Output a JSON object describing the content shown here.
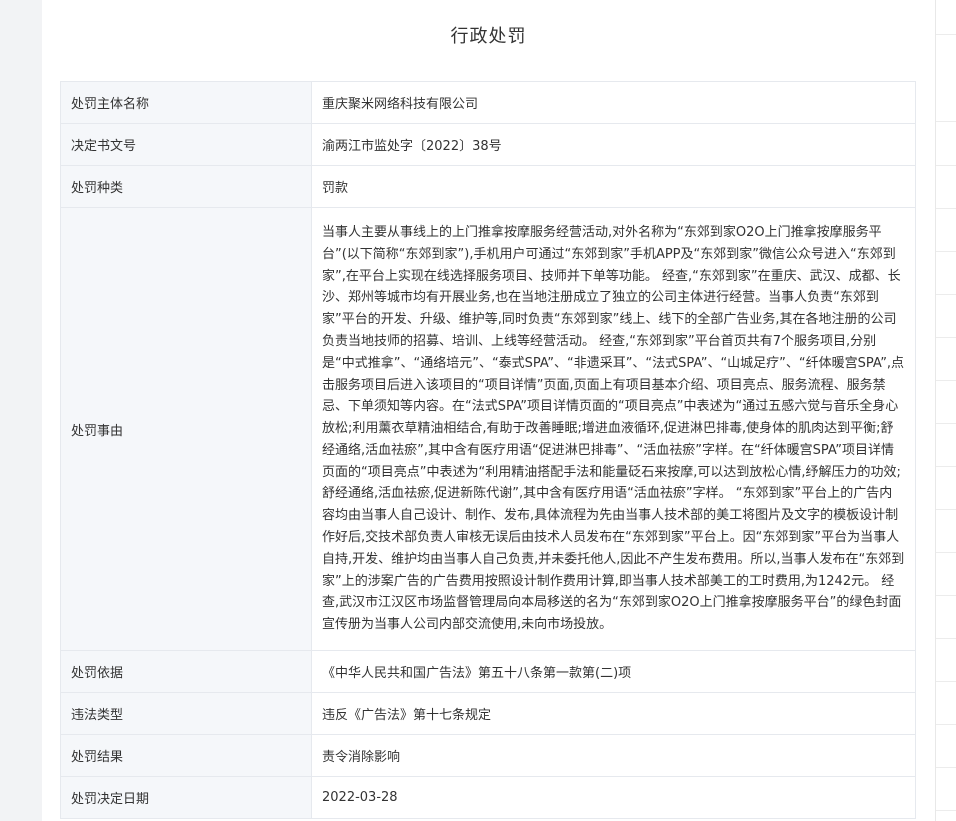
{
  "page": {
    "title": "行政处罚"
  },
  "rows": [
    {
      "label": "处罚主体名称",
      "value": "重庆聚米网络科技有限公司"
    },
    {
      "label": "决定书文号",
      "value": "渝两江市监处字〔2022〕38号"
    },
    {
      "label": "处罚种类",
      "value": "罚款"
    },
    {
      "label": "处罚事由",
      "value": "当事人主要从事线上的上门推拿按摩服务经营活动,对外名称为“东郊到家O2O上门推拿按摩服务平台”(以下简称“东郊到家”),手机用户可通过“东郊到家”手机APP及“东郊到家”微信公众号进入“东郊到家”,在平台上实现在线选择服务项目、技师并下单等功能。 经查,“东郊到家”在重庆、武汉、成都、长沙、郑州等城市均有开展业务,也在当地注册成立了独立的公司主体进行经营。当事人负责“东郊到家”平台的开发、升级、维护等,同时负责“东郊到家”线上、线下的全部广告业务,其在各地注册的公司负责当地技师的招募、培训、上线等经营活动。 经查,“东郊到家”平台首页共有7个服务项目,分别是“中式推拿”、“通络培元”、“泰式SPA”、“非遗采耳”、“法式SPA”、“山城足疗”、“纤体暖宫SPA”,点击服务项目后进入该项目的“项目详情”页面,页面上有项目基本介绍、项目亮点、服务流程、服务禁忌、下单须知等内容。在“法式SPA”项目详情页面的“项目亮点”中表述为“通过五感六觉与音乐全身心放松;利用薰衣草精油相结合,有助于改善睡眠;增进血液循环,促进淋巴排毒,使身体的肌肉达到平衡;舒经通络,活血祛瘀”,其中含有医疗用语“促进淋巴排毒”、“活血祛瘀”字样。在“纤体暖宫SPA”项目详情页面的“项目亮点”中表述为“利用精油搭配手法和能量砭石来按摩,可以达到放松心情,纾解压力的功效;舒经通络,活血祛瘀,促进新陈代谢”,其中含有医疗用语“活血祛瘀”字样。 “东郊到家”平台上的广告内容均由当事人自己设计、制作、发布,具体流程为先由当事人技术部的美工将图片及文字的模板设计制作好后,交技术部负责人审核无误后由技术人员发布在“东郊到家”平台上。因“东郊到家”平台为当事人自持,开发、维护均由当事人自己负责,并未委托他人,因此不产生发布费用。所以,当事人发布在“东郊到家”上的涉案广告的广告费用按照设计制作费用计算,即当事人技术部美工的工时费用,为1242元。 经查,武汉市江汉区市场监督管理局向本局移送的名为“东郊到家O2O上门推拿按摩服务平台”的绿色封面宣传册为当事人公司内部交流使用,未向市场投放。"
    },
    {
      "label": "处罚依据",
      "value": "《中华人民共和国广告法》第五十八条第一款第(二)项"
    },
    {
      "label": "违法类型",
      "value": "违反《广告法》第十七条规定"
    },
    {
      "label": "处罚结果",
      "value": "责令消除影响"
    },
    {
      "label": "处罚决定日期",
      "value": "2022-03-28"
    }
  ]
}
